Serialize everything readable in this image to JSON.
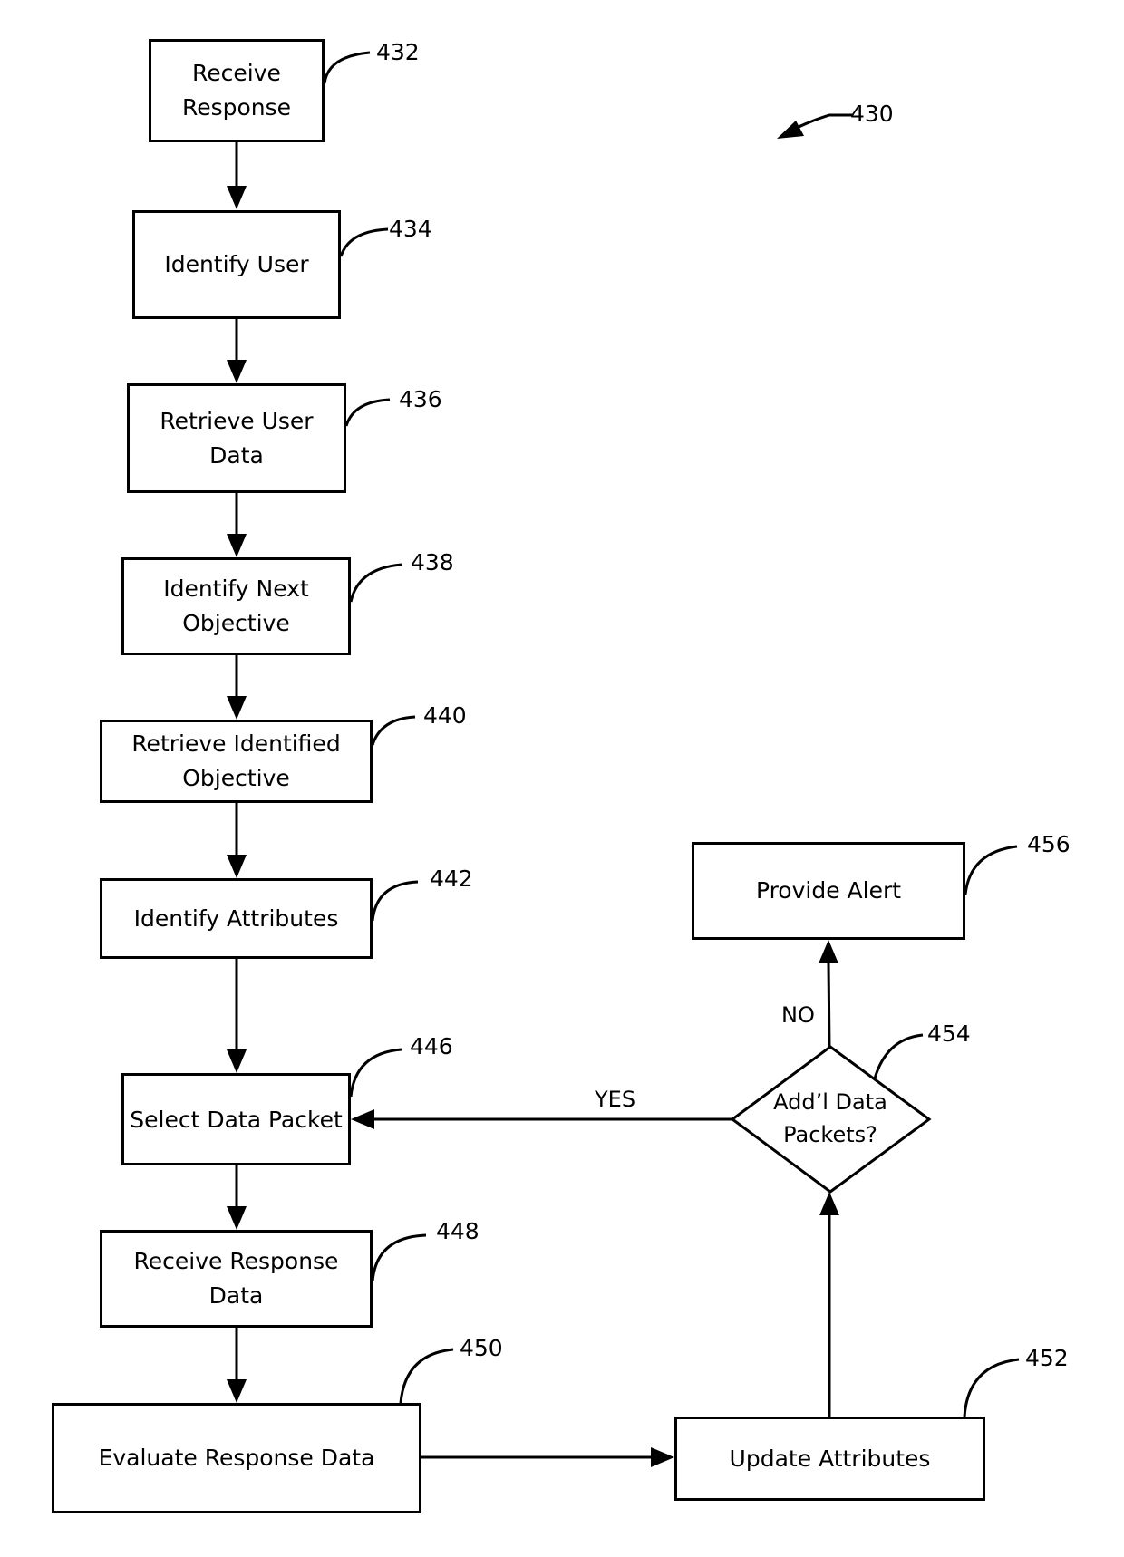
{
  "figure": {
    "ref": "430",
    "steps": [
      {
        "id": "432",
        "label": "Receive\nResponse",
        "lines": [
          "Receive",
          "Response"
        ]
      },
      {
        "id": "434",
        "label": "Identify User",
        "lines": [
          "Identify User"
        ]
      },
      {
        "id": "436",
        "label": "Retrieve User Data",
        "lines": [
          "Retrieve User",
          "Data"
        ]
      },
      {
        "id": "438",
        "label": "Identify Next Objective",
        "lines": [
          "Identify Next",
          "Objective"
        ]
      },
      {
        "id": "440",
        "label": "Retrieve Identified Objective",
        "lines": [
          "Retrieve Identified",
          "Objective"
        ]
      },
      {
        "id": "442",
        "label": "Identify Attributes",
        "lines": [
          "Identify Attributes"
        ]
      },
      {
        "id": "446",
        "label": "Select Data Packet",
        "lines": [
          "Select Data Packet"
        ]
      },
      {
        "id": "448",
        "label": "Receive Response Data",
        "lines": [
          "Receive Response",
          "Data"
        ]
      },
      {
        "id": "450",
        "label": "Evaluate Response Data",
        "lines": [
          "Evaluate Response Data"
        ]
      },
      {
        "id": "452",
        "label": "Update Attributes",
        "lines": [
          "Update Attributes"
        ]
      },
      {
        "id": "456",
        "label": "Provide Alert",
        "lines": [
          "Provide Alert"
        ]
      }
    ],
    "decision": {
      "id": "454",
      "lines": [
        "Add’l Data",
        "Packets?"
      ]
    },
    "edge_labels": {
      "yes": "YES",
      "no": "NO"
    }
  }
}
